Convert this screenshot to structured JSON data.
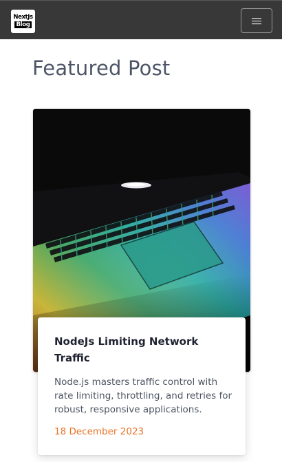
{
  "navbar": {
    "logo": {
      "line1": "NextJs",
      "line2": "Blog"
    },
    "menu_icon": "hamburger-icon"
  },
  "main": {
    "section_title": "Featured Post",
    "featured_post": {
      "image": "laptop-keyboard-rgb-image",
      "title": "NodeJs Limiting Network Traffic",
      "description": "Node.js masters traffic control with rate limiting, throttling, and retries for robust, responsive applications.",
      "date": "18 December 2023"
    }
  },
  "colors": {
    "navbar_bg": "#383838",
    "title_text": "#4c5566",
    "date_accent": "#e8752a"
  }
}
